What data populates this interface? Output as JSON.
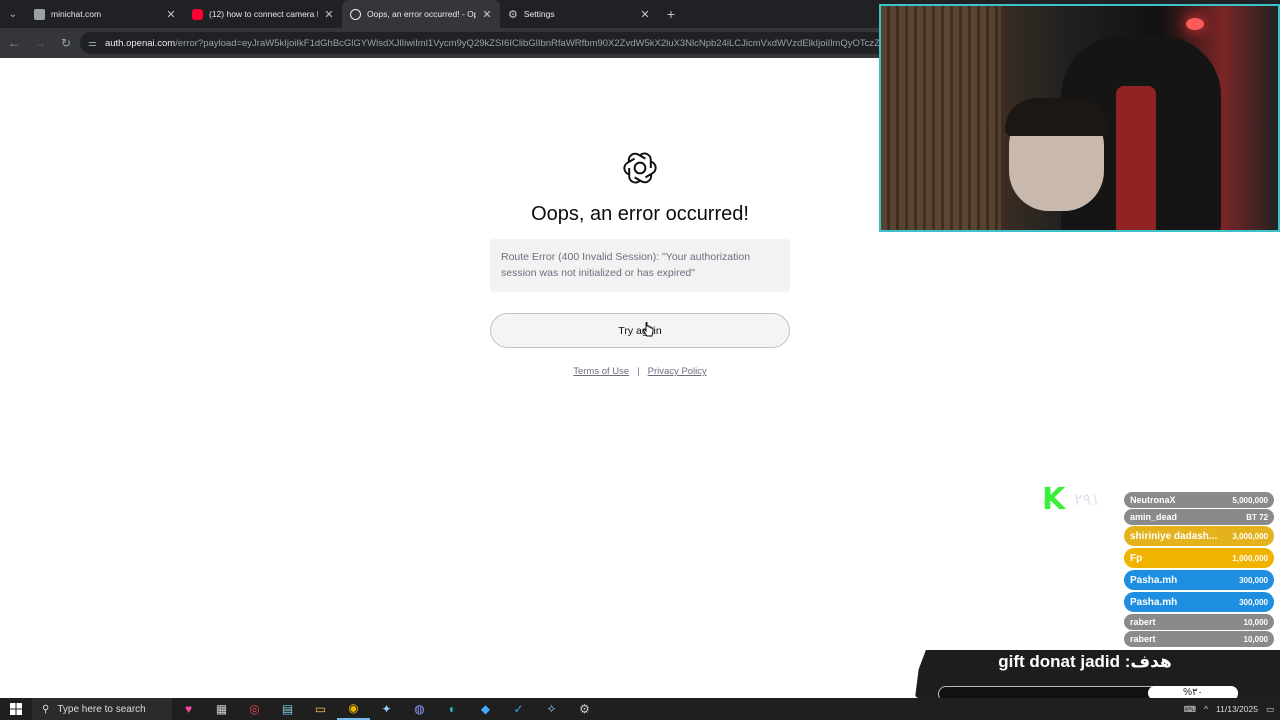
{
  "browser": {
    "tabs": [
      {
        "title": "minichat.com",
        "icon": "minichat-favicon",
        "active": false
      },
      {
        "title": "(12) how to connect camera fo",
        "icon": "youtube-favicon",
        "active": false
      },
      {
        "title": "Oops, an error occurred! - Ope",
        "icon": "openai-favicon",
        "active": true
      },
      {
        "title": "Settings",
        "icon": "settings-gear-icon",
        "active": false
      }
    ],
    "url_host": "auth.openai.com",
    "url_path": "/error?payload=eyJraW5kIjoiIkF1dGhBcGlGYWlsdXJlIiwiIml1Vycm9yQ29kZSI6IClibGlIbnRfaWRfbm90X2ZvdW5kX2luX3NlcNpb24iLCJicmVxdWVzdElkIjoiIlmQyOTczZjFiYmN"
  },
  "page": {
    "heading": "Oops, an error occurred!",
    "error_message": "Route Error (400 Invalid Session): \"Your authorization session was not initialized or has expired\"",
    "retry_label": "Try again",
    "terms_label": "Terms of Use",
    "separator": "|",
    "privacy_label": "Privacy Policy"
  },
  "overlay": {
    "k_logo": "K",
    "k_sub": "۲۹۱",
    "donations": [
      {
        "name": "NeutronaX",
        "amount": "5,000,000",
        "color": "#8a8a8a",
        "big": false
      },
      {
        "name": "amin_dead",
        "amount": "BT 72",
        "color": "#8a8a8a",
        "big": false
      },
      {
        "name": "shiriniye dadash...",
        "amount": "3,000,000",
        "color": "#e3b21c",
        "big": true
      },
      {
        "name": "Fp",
        "amount": "1,000,000",
        "color": "#f0b400",
        "big": true
      },
      {
        "name": "Pasha.mh",
        "amount": "300,000",
        "color": "#1e8fe0",
        "big": true
      },
      {
        "name": "Pasha.mh",
        "amount": "300,000",
        "color": "#1e8fe0",
        "big": true
      },
      {
        "name": "rabert",
        "amount": "10,000",
        "color": "#8a8a8a",
        "big": false
      },
      {
        "name": "rabert",
        "amount": "10,000",
        "color": "#8a8a8a",
        "big": false
      }
    ],
    "goal_text": "gift donat jadid :هدف",
    "goal_percent": "%۳۰"
  },
  "taskbar": {
    "search_placeholder": "Type here to search",
    "date": "11/13/2025"
  }
}
